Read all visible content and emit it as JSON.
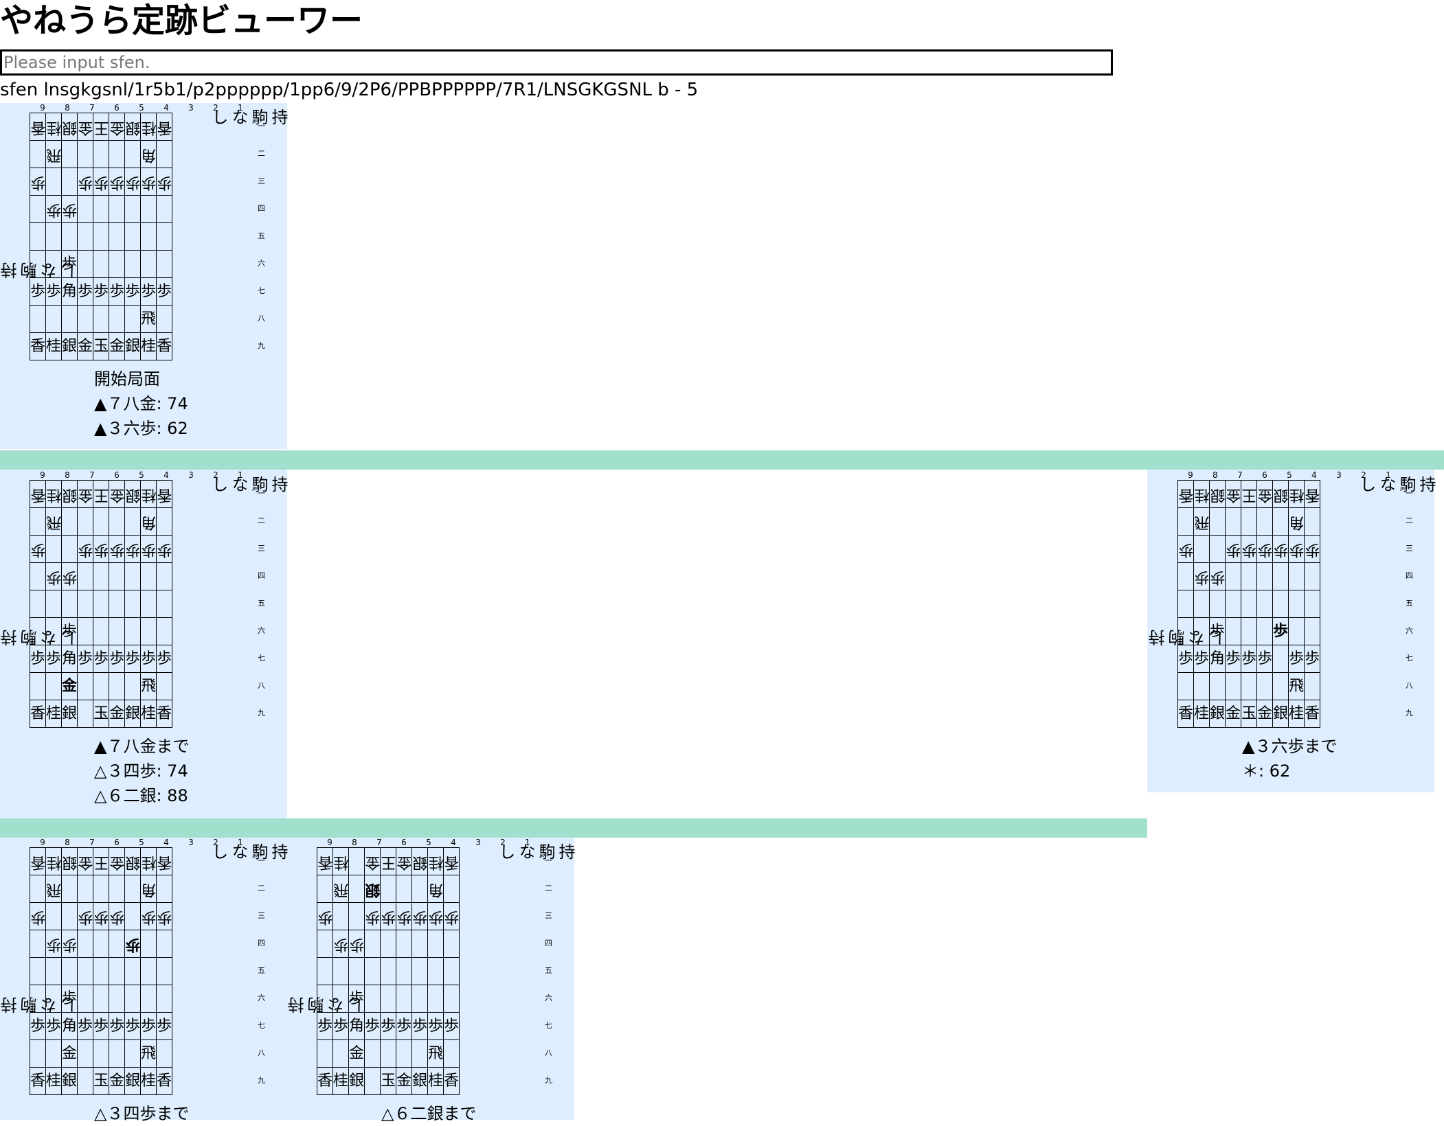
{
  "title": "やねうら定跡ビューワー",
  "input": {
    "placeholder": "Please input sfen.",
    "value": ""
  },
  "sfen_line": "sfen lnsgkgsnl/1r5b1/p2pppppp/1pp6/9/2P6/PPBPPPPPP/7R1/LNSGKGSNL b - 5",
  "column_labels": [
    "9",
    "8",
    "7",
    "6",
    "5",
    "4",
    "3",
    "2",
    "1"
  ],
  "row_labels": [
    "一",
    "二",
    "三",
    "四",
    "五",
    "六",
    "七",
    "八",
    "九"
  ],
  "colors": {
    "panel": "#deeefe",
    "separator": "#a1e0cd"
  },
  "boards": [
    {
      "id": "start",
      "hand_gote": "持駒なし",
      "hand_sente": "持駒なし",
      "squares": [
        [
          [
            "香",
            "g"
          ],
          [
            "桂",
            "g"
          ],
          [
            "銀",
            "g"
          ],
          [
            "金",
            "g"
          ],
          [
            "王",
            "g"
          ],
          [
            "金",
            "g"
          ],
          [
            "銀",
            "g"
          ],
          [
            "桂",
            "g"
          ],
          [
            "香",
            "g"
          ]
        ],
        [
          null,
          [
            "飛",
            "g"
          ],
          null,
          null,
          null,
          null,
          null,
          [
            "角",
            "g"
          ],
          null
        ],
        [
          [
            "歩",
            "g"
          ],
          null,
          null,
          [
            "歩",
            "g"
          ],
          [
            "歩",
            "g"
          ],
          [
            "歩",
            "g"
          ],
          [
            "歩",
            "g"
          ],
          [
            "歩",
            "g"
          ],
          [
            "歩",
            "g"
          ]
        ],
        [
          null,
          [
            "歩",
            "g"
          ],
          [
            "歩",
            "g"
          ],
          null,
          null,
          null,
          null,
          null,
          null
        ],
        [
          null,
          null,
          null,
          null,
          null,
          null,
          null,
          null,
          null
        ],
        [
          null,
          null,
          [
            "歩",
            "s"
          ],
          null,
          null,
          null,
          null,
          null,
          null
        ],
        [
          [
            "歩",
            "s"
          ],
          [
            "歩",
            "s"
          ],
          [
            "角",
            "s"
          ],
          [
            "歩",
            "s"
          ],
          [
            "歩",
            "s"
          ],
          [
            "歩",
            "s"
          ],
          [
            "歩",
            "s"
          ],
          [
            "歩",
            "s"
          ],
          [
            "歩",
            "s"
          ]
        ],
        [
          null,
          null,
          null,
          null,
          null,
          null,
          null,
          [
            "飛",
            "s"
          ],
          null
        ],
        [
          [
            "香",
            "s"
          ],
          [
            "桂",
            "s"
          ],
          [
            "銀",
            "s"
          ],
          [
            "金",
            "s"
          ],
          [
            "玉",
            "s"
          ],
          [
            "金",
            "s"
          ],
          [
            "銀",
            "s"
          ],
          [
            "桂",
            "s"
          ],
          [
            "香",
            "s"
          ]
        ]
      ],
      "info": [
        "開始局面",
        "▲７八金: 74",
        "▲３六歩: 62"
      ]
    },
    {
      "id": "after-78kin",
      "hand_gote": "持駒なし",
      "hand_sente": "持駒なし",
      "squares": [
        [
          [
            "香",
            "g"
          ],
          [
            "桂",
            "g"
          ],
          [
            "銀",
            "g"
          ],
          [
            "金",
            "g"
          ],
          [
            "王",
            "g"
          ],
          [
            "金",
            "g"
          ],
          [
            "銀",
            "g"
          ],
          [
            "桂",
            "g"
          ],
          [
            "香",
            "g"
          ]
        ],
        [
          null,
          [
            "飛",
            "g"
          ],
          null,
          null,
          null,
          null,
          null,
          [
            "角",
            "g"
          ],
          null
        ],
        [
          [
            "歩",
            "g"
          ],
          null,
          null,
          [
            "歩",
            "g"
          ],
          [
            "歩",
            "g"
          ],
          [
            "歩",
            "g"
          ],
          [
            "歩",
            "g"
          ],
          [
            "歩",
            "g"
          ],
          [
            "歩",
            "g"
          ]
        ],
        [
          null,
          [
            "歩",
            "g"
          ],
          [
            "歩",
            "g"
          ],
          null,
          null,
          null,
          null,
          null,
          null
        ],
        [
          null,
          null,
          null,
          null,
          null,
          null,
          null,
          null,
          null
        ],
        [
          null,
          null,
          [
            "歩",
            "s"
          ],
          null,
          null,
          null,
          null,
          null,
          null
        ],
        [
          [
            "歩",
            "s"
          ],
          [
            "歩",
            "s"
          ],
          [
            "角",
            "s"
          ],
          [
            "歩",
            "s"
          ],
          [
            "歩",
            "s"
          ],
          [
            "歩",
            "s"
          ],
          [
            "歩",
            "s"
          ],
          [
            "歩",
            "s"
          ],
          [
            "歩",
            "s"
          ]
        ],
        [
          null,
          null,
          [
            "金",
            "sb"
          ],
          null,
          null,
          null,
          null,
          [
            "飛",
            "s"
          ],
          null
        ],
        [
          [
            "香",
            "s"
          ],
          [
            "桂",
            "s"
          ],
          [
            "銀",
            "s"
          ],
          null,
          [
            "玉",
            "s"
          ],
          [
            "金",
            "s"
          ],
          [
            "銀",
            "s"
          ],
          [
            "桂",
            "s"
          ],
          [
            "香",
            "s"
          ]
        ]
      ],
      "info": [
        "▲７八金まで",
        "△３四歩: 74",
        "△６二銀: 88"
      ]
    },
    {
      "id": "after-36fu",
      "hand_gote": "持駒なし",
      "hand_sente": "持駒なし",
      "squares": [
        [
          [
            "香",
            "g"
          ],
          [
            "桂",
            "g"
          ],
          [
            "銀",
            "g"
          ],
          [
            "金",
            "g"
          ],
          [
            "王",
            "g"
          ],
          [
            "金",
            "g"
          ],
          [
            "銀",
            "g"
          ],
          [
            "桂",
            "g"
          ],
          [
            "香",
            "g"
          ]
        ],
        [
          null,
          [
            "飛",
            "g"
          ],
          null,
          null,
          null,
          null,
          null,
          [
            "角",
            "g"
          ],
          null
        ],
        [
          [
            "歩",
            "g"
          ],
          null,
          null,
          [
            "歩",
            "g"
          ],
          [
            "歩",
            "g"
          ],
          [
            "歩",
            "g"
          ],
          [
            "歩",
            "g"
          ],
          [
            "歩",
            "g"
          ],
          [
            "歩",
            "g"
          ]
        ],
        [
          null,
          [
            "歩",
            "g"
          ],
          [
            "歩",
            "g"
          ],
          null,
          null,
          null,
          null,
          null,
          null
        ],
        [
          null,
          null,
          null,
          null,
          null,
          null,
          null,
          null,
          null
        ],
        [
          null,
          null,
          [
            "歩",
            "s"
          ],
          null,
          null,
          null,
          [
            "歩",
            "sb"
          ],
          null,
          null
        ],
        [
          [
            "歩",
            "s"
          ],
          [
            "歩",
            "s"
          ],
          [
            "角",
            "s"
          ],
          [
            "歩",
            "s"
          ],
          [
            "歩",
            "s"
          ],
          [
            "歩",
            "s"
          ],
          null,
          [
            "歩",
            "s"
          ],
          [
            "歩",
            "s"
          ]
        ],
        [
          null,
          null,
          null,
          null,
          null,
          null,
          null,
          [
            "飛",
            "s"
          ],
          null
        ],
        [
          [
            "香",
            "s"
          ],
          [
            "桂",
            "s"
          ],
          [
            "銀",
            "s"
          ],
          [
            "金",
            "s"
          ],
          [
            "玉",
            "s"
          ],
          [
            "金",
            "s"
          ],
          [
            "銀",
            "s"
          ],
          [
            "桂",
            "s"
          ],
          [
            "香",
            "s"
          ]
        ]
      ],
      "info": [
        "▲３六歩まで",
        "＊: 62"
      ]
    },
    {
      "id": "after-34fu",
      "hand_gote": "持駒なし",
      "hand_sente": "持駒なし",
      "squares": [
        [
          [
            "香",
            "g"
          ],
          [
            "桂",
            "g"
          ],
          [
            "銀",
            "g"
          ],
          [
            "金",
            "g"
          ],
          [
            "王",
            "g"
          ],
          [
            "金",
            "g"
          ],
          [
            "銀",
            "g"
          ],
          [
            "桂",
            "g"
          ],
          [
            "香",
            "g"
          ]
        ],
        [
          null,
          [
            "飛",
            "g"
          ],
          null,
          null,
          null,
          null,
          null,
          [
            "角",
            "g"
          ],
          null
        ],
        [
          [
            "歩",
            "g"
          ],
          null,
          null,
          [
            "歩",
            "g"
          ],
          [
            "歩",
            "g"
          ],
          [
            "歩",
            "g"
          ],
          null,
          [
            "歩",
            "g"
          ],
          [
            "歩",
            "g"
          ]
        ],
        [
          null,
          [
            "歩",
            "g"
          ],
          [
            "歩",
            "g"
          ],
          null,
          null,
          null,
          [
            "歩",
            "gb"
          ],
          null,
          null
        ],
        [
          null,
          null,
          null,
          null,
          null,
          null,
          null,
          null,
          null
        ],
        [
          null,
          null,
          [
            "歩",
            "s"
          ],
          null,
          null,
          null,
          null,
          null,
          null
        ],
        [
          [
            "歩",
            "s"
          ],
          [
            "歩",
            "s"
          ],
          [
            "角",
            "s"
          ],
          [
            "歩",
            "s"
          ],
          [
            "歩",
            "s"
          ],
          [
            "歩",
            "s"
          ],
          [
            "歩",
            "s"
          ],
          [
            "歩",
            "s"
          ],
          [
            "歩",
            "s"
          ]
        ],
        [
          null,
          null,
          [
            "金",
            "s"
          ],
          null,
          null,
          null,
          null,
          [
            "飛",
            "s"
          ],
          null
        ],
        [
          [
            "香",
            "s"
          ],
          [
            "桂",
            "s"
          ],
          [
            "銀",
            "s"
          ],
          null,
          [
            "玉",
            "s"
          ],
          [
            "金",
            "s"
          ],
          [
            "銀",
            "s"
          ],
          [
            "桂",
            "s"
          ],
          [
            "香",
            "s"
          ]
        ]
      ],
      "info": [
        "△３四歩まで"
      ]
    },
    {
      "id": "after-62gin",
      "hand_gote": "持駒なし",
      "hand_sente": "持駒なし",
      "squares": [
        [
          [
            "香",
            "g"
          ],
          [
            "桂",
            "g"
          ],
          null,
          [
            "金",
            "g"
          ],
          [
            "王",
            "g"
          ],
          [
            "金",
            "g"
          ],
          [
            "銀",
            "g"
          ],
          [
            "桂",
            "g"
          ],
          [
            "香",
            "g"
          ]
        ],
        [
          null,
          [
            "飛",
            "g"
          ],
          null,
          [
            "銀",
            "gb"
          ],
          null,
          null,
          null,
          [
            "角",
            "g"
          ],
          null
        ],
        [
          [
            "歩",
            "g"
          ],
          null,
          null,
          [
            "歩",
            "g"
          ],
          [
            "歩",
            "g"
          ],
          [
            "歩",
            "g"
          ],
          [
            "歩",
            "g"
          ],
          [
            "歩",
            "g"
          ],
          [
            "歩",
            "g"
          ]
        ],
        [
          null,
          [
            "歩",
            "g"
          ],
          [
            "歩",
            "g"
          ],
          null,
          null,
          null,
          null,
          null,
          null
        ],
        [
          null,
          null,
          null,
          null,
          null,
          null,
          null,
          null,
          null
        ],
        [
          null,
          null,
          [
            "歩",
            "s"
          ],
          null,
          null,
          null,
          null,
          null,
          null
        ],
        [
          [
            "歩",
            "s"
          ],
          [
            "歩",
            "s"
          ],
          [
            "角",
            "s"
          ],
          [
            "歩",
            "s"
          ],
          [
            "歩",
            "s"
          ],
          [
            "歩",
            "s"
          ],
          [
            "歩",
            "s"
          ],
          [
            "歩",
            "s"
          ],
          [
            "歩",
            "s"
          ]
        ],
        [
          null,
          null,
          [
            "金",
            "s"
          ],
          null,
          null,
          null,
          null,
          [
            "飛",
            "s"
          ],
          null
        ],
        [
          [
            "香",
            "s"
          ],
          [
            "桂",
            "s"
          ],
          [
            "銀",
            "s"
          ],
          null,
          [
            "玉",
            "s"
          ],
          [
            "金",
            "s"
          ],
          [
            "銀",
            "s"
          ],
          [
            "桂",
            "s"
          ],
          [
            "香",
            "s"
          ]
        ]
      ],
      "info": [
        "△６二銀まで"
      ]
    }
  ]
}
